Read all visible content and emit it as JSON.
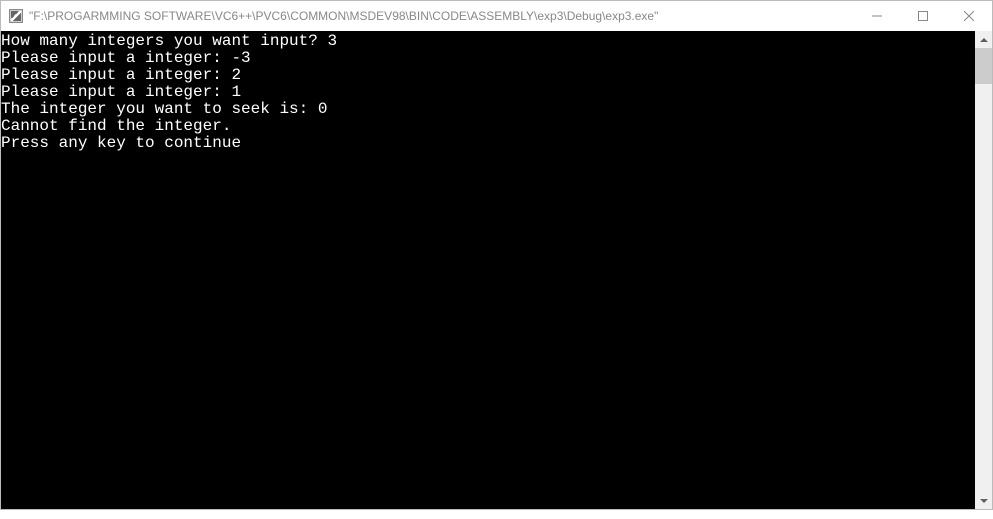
{
  "window": {
    "title": "\"F:\\PROGARMMING SOFTWARE\\VC6++\\PVC6\\COMMON\\MSDEV98\\BIN\\CODE\\ASSEMBLY\\exp3\\Debug\\exp3.exe\""
  },
  "console": {
    "lines": [
      "How many integers you want input? 3",
      "Please input a integer: -3",
      "Please input a integer: 2",
      "Please input a integer: 1",
      "The integer you want to seek is: 0",
      "Cannot find the integer.",
      "Press any key to continue"
    ]
  }
}
